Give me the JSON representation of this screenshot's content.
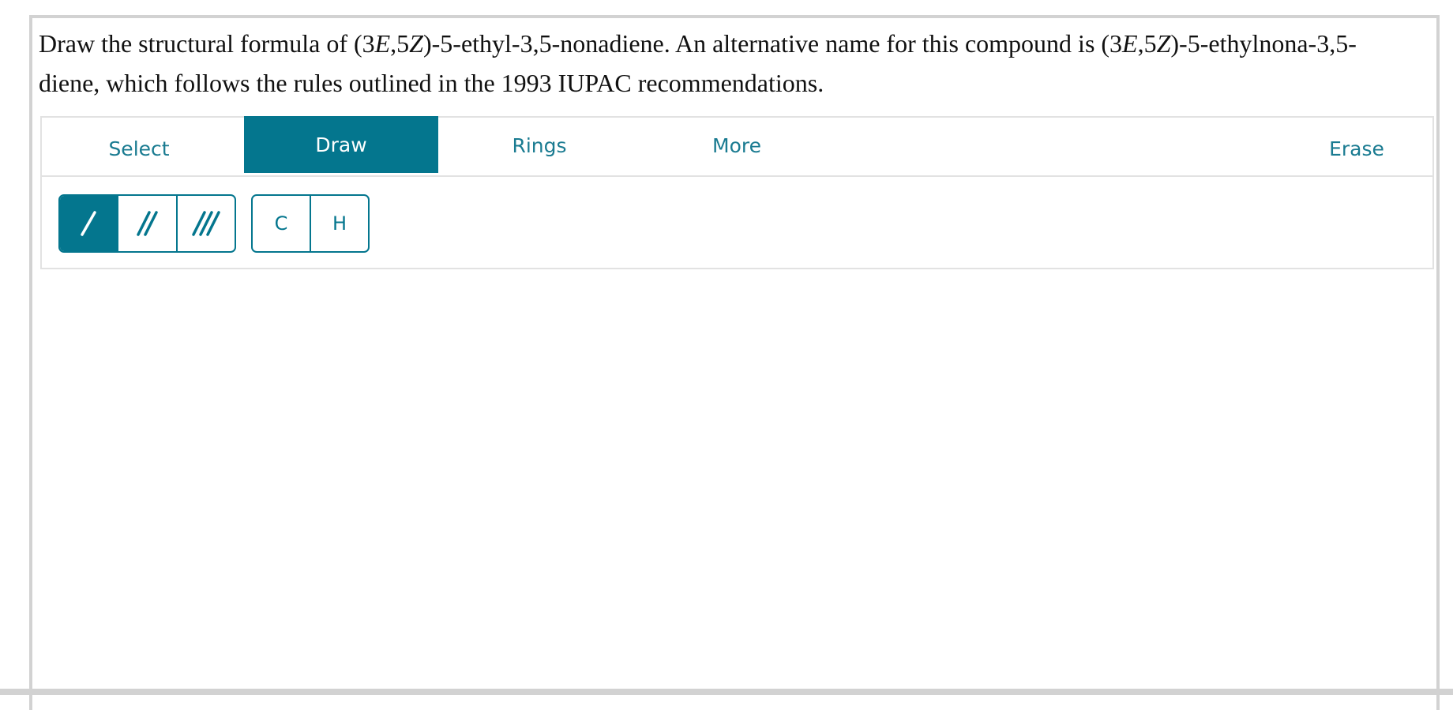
{
  "question": {
    "part1": "Draw the structural formula of (3",
    "e1": "E",
    "part2": ",5",
    "z1": "Z",
    "part3": ")-5-ethyl-3,5-nonadiene. An alternative name for this compound is (3",
    "e2": "E",
    "part4": ",5",
    "z2": "Z",
    "part5": ")-5-ethylnona-3,5-diene, which follows the rules outlined in the 1993 IUPAC recommendations."
  },
  "toolbar": {
    "tabs": [
      {
        "label": "Select",
        "active": false
      },
      {
        "label": "Draw",
        "active": true
      },
      {
        "label": "Rings",
        "active": false
      },
      {
        "label": "More",
        "active": false
      }
    ],
    "erase_label": "Erase"
  },
  "draw_tools": {
    "bonds": [
      {
        "icon": "single-bond-icon",
        "active": true
      },
      {
        "icon": "double-bond-icon",
        "active": false
      },
      {
        "icon": "triple-bond-icon",
        "active": false
      }
    ],
    "atoms": [
      {
        "label": "C"
      },
      {
        "label": "H"
      }
    ]
  },
  "colors": {
    "accent": "#04768e",
    "tab_text": "#1a7b91",
    "border": "#d2d2d2"
  }
}
